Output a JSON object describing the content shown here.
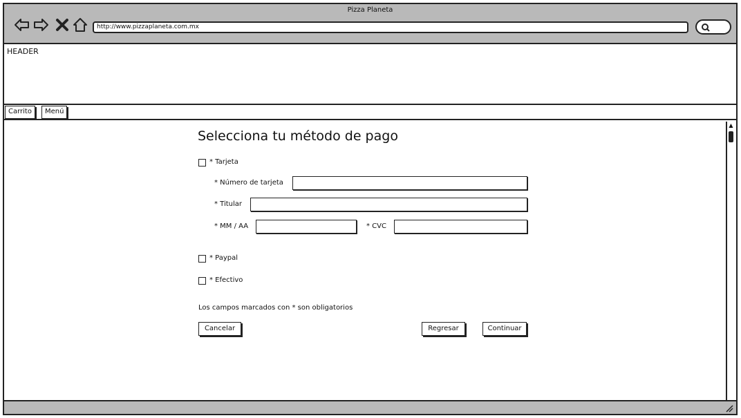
{
  "window": {
    "title": "Pizza Planeta"
  },
  "browser": {
    "url": "http://www.pizzaplaneta.com.mx"
  },
  "header": {
    "label": "HEADER"
  },
  "tabs": [
    {
      "label": "Carrito"
    },
    {
      "label": "Menú"
    }
  ],
  "form": {
    "title": "Selecciona tu método de pago",
    "options": [
      {
        "label": "* Tarjeta",
        "checked": false
      },
      {
        "label": "* Paypal",
        "checked": false
      },
      {
        "label": "* Efectivo",
        "checked": false
      }
    ],
    "card_fields": {
      "number_label": "* Número de tarjeta",
      "holder_label": "* Titular",
      "expiry_label": "* MM / AA",
      "cvc_label": "* CVC"
    },
    "note": "Los campos marcados con * son obligatorios",
    "buttons": {
      "cancel": "Cancelar",
      "back": "Regresar",
      "continue": "Continuar"
    }
  }
}
